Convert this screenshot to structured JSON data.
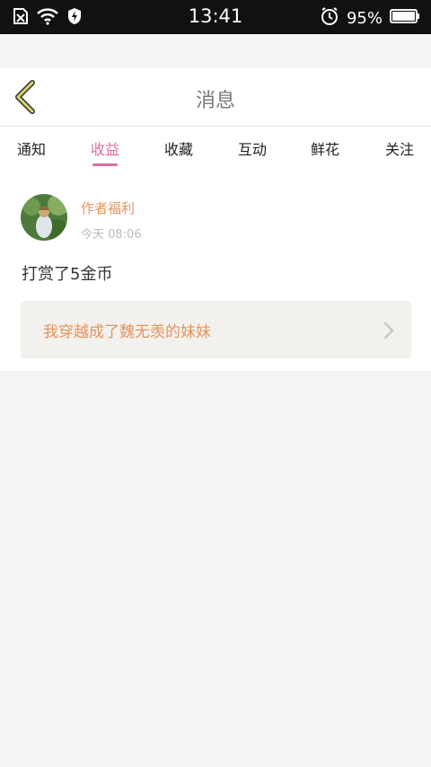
{
  "status_bar": {
    "time": "13:41",
    "battery": "95%",
    "icons": [
      "sim-error-icon",
      "wifi-icon",
      "shield-icon",
      "alarm-icon",
      "battery-icon"
    ]
  },
  "header": {
    "title": "消息",
    "back_icon": "chevron-left-icon"
  },
  "tabs": [
    {
      "label": "通知"
    },
    {
      "label": "收益"
    },
    {
      "label": "收藏"
    },
    {
      "label": "互动"
    },
    {
      "label": "鲜花"
    },
    {
      "label": "关注"
    }
  ],
  "active_tab": "收益",
  "message": {
    "author": "作者福利",
    "time": "今天 08:06",
    "text": "打赏了5金币",
    "book_title": "我穿越成了魏无羡的妹妹"
  },
  "colors": {
    "accent_pink": "#e46aa0",
    "accent_orange": "#e6935d",
    "back_arrow": "#c9c95a"
  }
}
